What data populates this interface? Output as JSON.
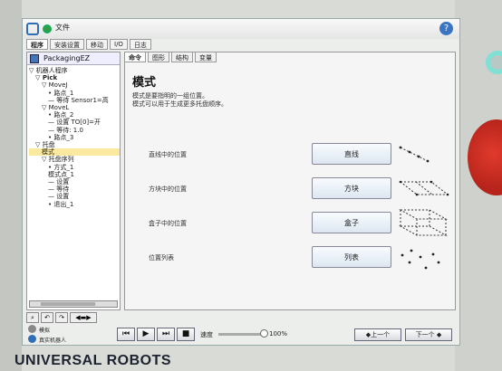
{
  "window": {
    "title": "文件"
  },
  "tabs": [
    "程序",
    "安装设置",
    "移动",
    "I/O",
    "日志"
  ],
  "program": {
    "name": "PackagingEZ"
  },
  "tree": [
    {
      "text": "▽ 机器人程序",
      "indent": 0
    },
    {
      "text": "▽ Pick",
      "indent": 1,
      "bold": true
    },
    {
      "text": "▽ MoveJ",
      "indent": 2
    },
    {
      "text": "• 路点_1",
      "indent": 3
    },
    {
      "text": "— 等待 Sensor1=高",
      "indent": 3
    },
    {
      "text": "▽ MoveL",
      "indent": 2
    },
    {
      "text": "• 路点_2",
      "indent": 3
    },
    {
      "text": "— 设置 TO[0]=开",
      "indent": 3
    },
    {
      "text": "— 等待: 1.0",
      "indent": 3
    },
    {
      "text": "• 路点_3",
      "indent": 3
    },
    {
      "text": "▽ 托盘",
      "indent": 1
    },
    {
      "text": "模式",
      "indent": 2,
      "selected": true
    },
    {
      "text": "▽ 托盘序列",
      "indent": 2
    },
    {
      "text": "• 方式_1",
      "indent": 3
    },
    {
      "text": "模式点_1",
      "indent": 3
    },
    {
      "text": "— 设置",
      "indent": 3
    },
    {
      "text": "— 等待",
      "indent": 3
    },
    {
      "text": "— 设置",
      "indent": 3
    },
    {
      "text": "• 退出_1",
      "indent": 3
    }
  ],
  "subtabs": [
    "命令",
    "图形",
    "结构",
    "变量"
  ],
  "panel": {
    "title": "模式",
    "desc1": "模式是要指明的一组位置。",
    "desc2": "模式可以用于生成更多托盘顺序。",
    "patterns": [
      {
        "label": "直线中的位置",
        "button": "直线",
        "icon": "line-pattern-icon"
      },
      {
        "label": "方块中的位置",
        "button": "方块",
        "icon": "square-pattern-icon"
      },
      {
        "label": "盒子中的位置",
        "button": "盒子",
        "icon": "box-pattern-icon"
      },
      {
        "label": "位置列表",
        "button": "列表",
        "icon": "list-pattern-icon"
      }
    ]
  },
  "status": {
    "line1": "模拟",
    "line2": "真实机器人"
  },
  "speed": {
    "label": "速度",
    "value": "100%",
    "fraction": 1.0
  },
  "nav": {
    "prev": "◆上一个",
    "next": "下一个 ◆"
  },
  "brand": "UNIVERSAL ROBOTS"
}
